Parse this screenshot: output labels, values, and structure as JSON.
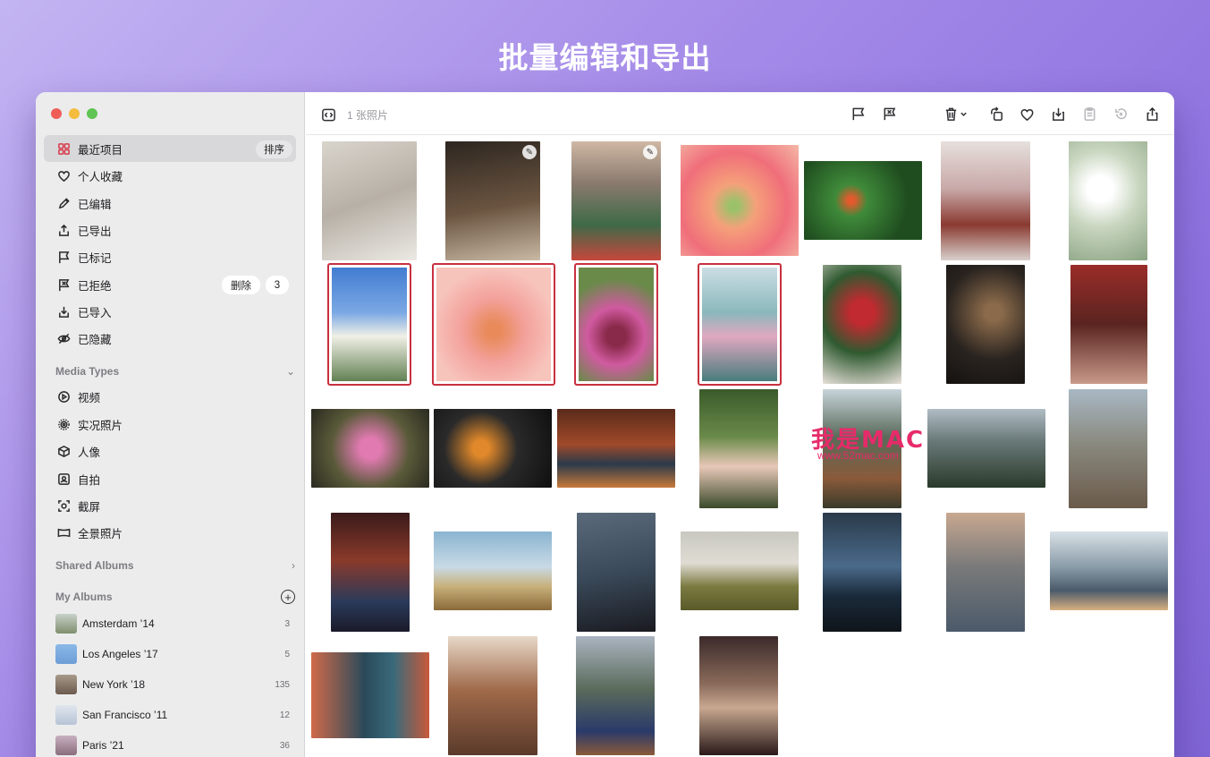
{
  "headline": "批量编辑和导出",
  "toolbar": {
    "photo_count": "1 张照片"
  },
  "sidebar": {
    "library": [
      {
        "label": "最近项目",
        "icon": "grid-icon",
        "badge": "排序",
        "active": true
      },
      {
        "label": "个人收藏",
        "icon": "heart-icon"
      },
      {
        "label": "已编辑",
        "icon": "pencil-icon"
      },
      {
        "label": "已导出",
        "icon": "export-icon"
      },
      {
        "label": "已标记",
        "icon": "flag-icon"
      },
      {
        "label": "已拒绝",
        "icon": "reject-flag-icon",
        "action": "删除",
        "count": "3"
      },
      {
        "label": "已导入",
        "icon": "import-icon"
      },
      {
        "label": "已隐藏",
        "icon": "hidden-icon"
      }
    ],
    "media_types_header": "Media Types",
    "media_types": [
      {
        "label": "视频",
        "icon": "play-icon"
      },
      {
        "label": "实况照片",
        "icon": "live-photo-icon"
      },
      {
        "label": "人像",
        "icon": "cube-icon"
      },
      {
        "label": "自拍",
        "icon": "selfie-icon"
      },
      {
        "label": "截屏",
        "icon": "screenshot-icon"
      },
      {
        "label": "全景照片",
        "icon": "panorama-icon"
      }
    ],
    "shared_albums_header": "Shared Albums",
    "my_albums_header": "My Albums",
    "albums": [
      {
        "name": "Amsterdam ’14",
        "count": "3",
        "color": "#7f8f6e"
      },
      {
        "name": "Los Angeles ’17",
        "count": "5",
        "color": "#6d9ed6"
      },
      {
        "name": "New York ’18",
        "count": "135",
        "color": "#6b5a4e"
      },
      {
        "name": "San Francisco ’11",
        "count": "12",
        "color": "#b7c4d6"
      },
      {
        "name": "Paris ’21",
        "count": "36",
        "color": "#8a6d7d"
      }
    ]
  },
  "watermark": {
    "main": "我是MAC",
    "sub": "www.52mac.com"
  },
  "photos": [
    {
      "name": "portrait-short-hair",
      "g": "linear-gradient(160deg,#d9d4cc,#b7b0a6 50%,#ece9e4)",
      "sel": false,
      "edit": false
    },
    {
      "name": "tea-pour",
      "g": "linear-gradient(170deg,#2d2620,#6a5440 55%,#c8b9a4)",
      "sel": false,
      "edit": true
    },
    {
      "name": "city-bridge",
      "g": "linear-gradient(180deg,#cfb8a4,#8a7a6e 35%,#3f6a48 70%,#c6473c)",
      "sel": false,
      "edit": true
    },
    {
      "name": "frog-on-flower",
      "g": "radial-gradient(circle at 45% 55%,#9bc26a 5%,#f5a07a 25%,#f06e7a 60%,#f4b8a6)",
      "sel": false,
      "edit": false
    },
    {
      "name": "green-tree-frog",
      "g": "radial-gradient(circle at 40% 50%,#e35a2c 4%,#3f8a3a 20%,#1f4d1f 70%)",
      "sel": false,
      "edit": false
    },
    {
      "name": "pagoda-blossom",
      "g": "linear-gradient(180deg,#e6e0dc,#c8a8a8 40%,#8a3a30 70%,#d8d0cc)",
      "sel": false,
      "edit": false
    },
    {
      "name": "white-blossom",
      "g": "radial-gradient(circle at 40% 40%,#ffffff 15%,#c9d6c0 45%,#8aa382)",
      "sel": false,
      "edit": false
    },
    {
      "name": "blossom-blue-sky",
      "g": "linear-gradient(180deg,#3f7ad0,#7aa8e4 40%,#f0f0e6 60%,#5a7a4a)",
      "sel": true,
      "edit": false
    },
    {
      "name": "pink-peony",
      "g": "radial-gradient(circle at 50% 55%,#e88a5a 8%,#f3a09a 35%,#f7c4bc 70%)",
      "sel": true,
      "edit": false
    },
    {
      "name": "purple-peony",
      "g": "radial-gradient(circle at 50% 60%,#8a2a4a 12%,#d05aa0 35%,#6a8a4a 70%)",
      "sel": true,
      "edit": false
    },
    {
      "name": "lotus-pond",
      "g": "linear-gradient(180deg,#cfe0e6,#8ab8bc 40%,#e0a8c0 60%,#3f7a78)",
      "sel": true,
      "edit": false
    },
    {
      "name": "red-flowers-girl",
      "g": "radial-gradient(circle at 50% 40%,#c02a30 15%,#2f5a30 50%,#e8e0da)",
      "sel": false,
      "edit": false
    },
    {
      "name": "lights-woman",
      "g": "radial-gradient(circle at 60% 40%,#8a6a4a 10%,#2a2420 55%,#14110f)",
      "sel": false,
      "edit": false
    },
    {
      "name": "fan-woman",
      "g": "linear-gradient(180deg,#9a2c28,#5a2420 50%,#c89a8a)",
      "sel": false,
      "edit": false
    },
    {
      "name": "pink-lotus",
      "g": "radial-gradient(circle at 50% 50%,#e07ab0 15%,#5a5a3a 55%,#2a2a20)",
      "sel": false,
      "edit": false
    },
    {
      "name": "koi-fish",
      "g": "radial-gradient(circle at 40% 50%,#e0882a 10%,#2a2a2a 45%,#0f0f10)",
      "sel": false,
      "edit": false
    },
    {
      "name": "shrine-statue",
      "g": "linear-gradient(180deg,#5a2a1a,#a04a2a 45%,#2a3a4a 70%,#c87a3a)",
      "sel": false,
      "edit": false
    },
    {
      "name": "woman-in-leaves",
      "g": "linear-gradient(180deg,#3a5a2a,#6a8a4a 40%,#e8c8b8 65%,#3a4a2a)",
      "sel": false,
      "edit": false
    },
    {
      "name": "mountain-valley",
      "g": "linear-gradient(180deg,#c8d4da,#5a6a5a 40%,#8a5a3a 75%,#3a3a2a)",
      "sel": false,
      "edit": false
    },
    {
      "name": "stone-pillars",
      "g": "linear-gradient(180deg,#b0bcc4,#6a7a7a 40%,#2a3a2a)",
      "sel": false,
      "edit": false
    },
    {
      "name": "great-wall",
      "g": "linear-gradient(180deg,#a8b8c4,#8a8a80 45%,#6a5a4a)",
      "sel": false,
      "edit": false
    },
    {
      "name": "alley-lanterns",
      "g": "linear-gradient(180deg,#3a1a1a,#8a3a2a 40%,#2a3a5a 75%,#1a1a2a)",
      "sel": false,
      "edit": false
    },
    {
      "name": "girl-in-field",
      "g": "linear-gradient(180deg,#8ab4d0,#c8dae6 45%,#c8b07a 70%,#8a6a3a)",
      "sel": false,
      "edit": false
    },
    {
      "name": "woman-profile",
      "g": "linear-gradient(170deg,#5a6a7a,#3a4a5a 50%,#1a1a20)",
      "sel": false,
      "edit": false
    },
    {
      "name": "girl-arms-field",
      "g": "linear-gradient(180deg,#c8c8c0,#e0dcd4 40%,#7a7a40 70%,#5a5a2a)",
      "sel": false,
      "edit": false
    },
    {
      "name": "city-night",
      "g": "linear-gradient(180deg,#2a3a4a,#4a6a8a 45%,#1a2a3a 70%,#0f141a)",
      "sel": false,
      "edit": false
    },
    {
      "name": "man-with-camera",
      "g": "linear-gradient(180deg,#c8a890,#7a7a7a 45%,#4a5a6a)",
      "sel": false,
      "edit": false
    },
    {
      "name": "couple-seaside",
      "g": "linear-gradient(180deg,#d8e0e6,#8a9ca8 45%,#4a5a6a 75%,#d8b080)",
      "sel": false,
      "edit": false
    },
    {
      "name": "stairs-photographer",
      "g": "linear-gradient(90deg,#d06a4a,#2a4a5a 45%,#3a6a7a 70%,#c85a3a)",
      "sel": false,
      "edit": false
    },
    {
      "name": "street-cyclists",
      "g": "linear-gradient(180deg,#e8d8c8,#a06a4a 45%,#5a3a2a)",
      "sel": false,
      "edit": false
    },
    {
      "name": "mountain-friends",
      "g": "linear-gradient(180deg,#aab4c0,#5a6a5a 45%,#2a3a6a 80%,#8a5a3a)",
      "sel": false,
      "edit": false
    },
    {
      "name": "night-market",
      "g": "linear-gradient(180deg,#3a2a2a,#8a6a5a 40%,#c8a890 60%,#2a1a1a)",
      "sel": false,
      "edit": false
    }
  ]
}
